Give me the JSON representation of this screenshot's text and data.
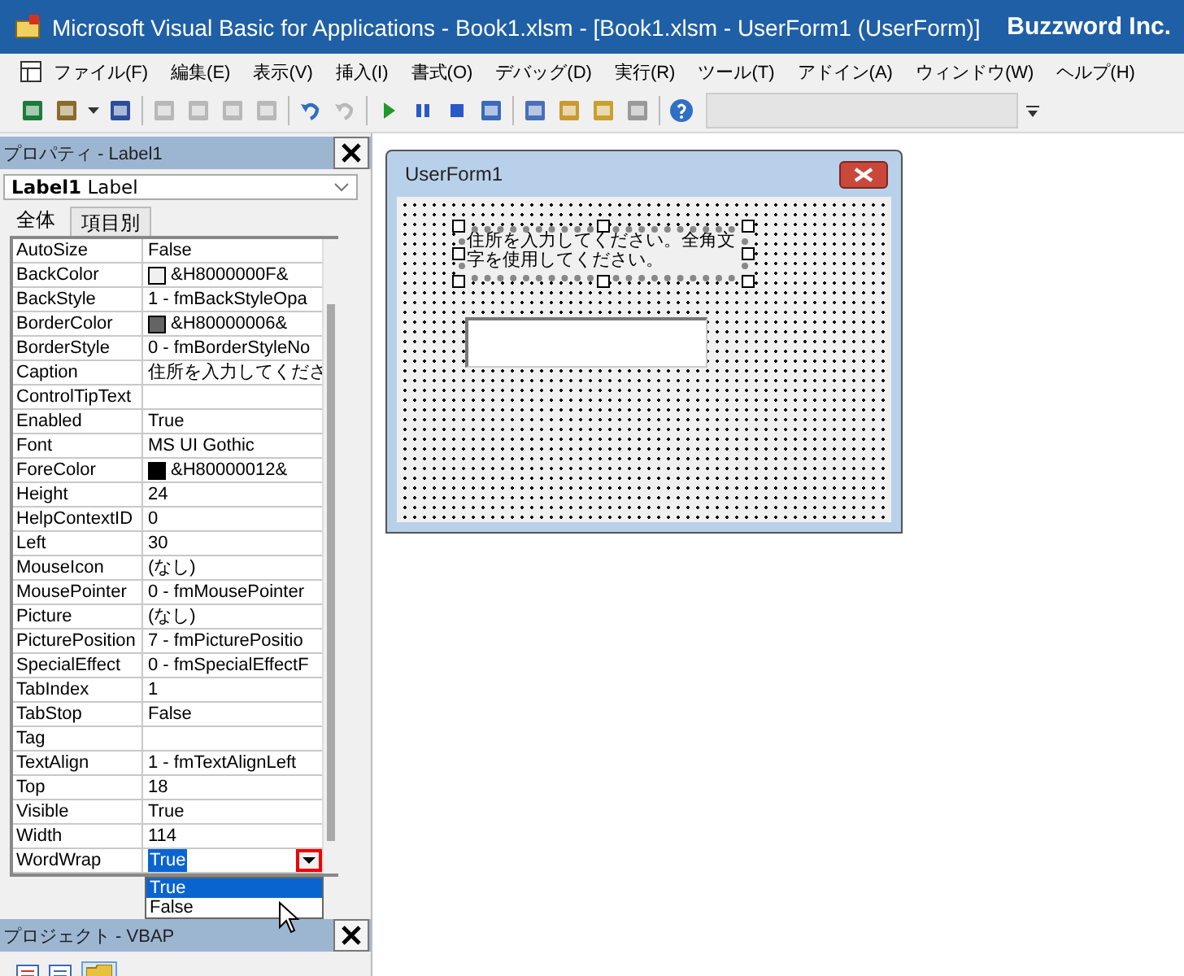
{
  "window": {
    "title": "Microsoft Visual Basic for Applications - Book1.xlsm - [Book1.xlsm - UserForm1 (UserForm)]",
    "brand": "Buzzword Inc."
  },
  "menu": [
    "ファイル(F)",
    "編集(E)",
    "表示(V)",
    "挿入(I)",
    "書式(O)",
    "デバッグ(D)",
    "実行(R)",
    "ツール(T)",
    "アドイン(A)",
    "ウィンドウ(W)",
    "ヘルプ(H)"
  ],
  "properties_panel": {
    "title": "プロパティ - Label1",
    "object_name": "Label1",
    "object_type": "Label",
    "tabs": [
      {
        "label": "全体",
        "selected": true
      },
      {
        "label": "項目別",
        "selected": false
      }
    ],
    "rows": [
      {
        "name": "AutoSize",
        "value": "False"
      },
      {
        "name": "BackColor",
        "value": "&H8000000F&",
        "color": "#f0f0f0"
      },
      {
        "name": "BackStyle",
        "value": "1 - fmBackStyleOpa"
      },
      {
        "name": "BorderColor",
        "value": "&H80000006&",
        "color": "#646464"
      },
      {
        "name": "BorderStyle",
        "value": "0 - fmBorderStyleNo"
      },
      {
        "name": "Caption",
        "value": "住所を入力してくださ"
      },
      {
        "name": "ControlTipText",
        "value": ""
      },
      {
        "name": "Enabled",
        "value": "True"
      },
      {
        "name": "Font",
        "value": "MS UI Gothic"
      },
      {
        "name": "ForeColor",
        "value": "&H80000012&",
        "color": "#000000"
      },
      {
        "name": "Height",
        "value": "24"
      },
      {
        "name": "HelpContextID",
        "value": "0"
      },
      {
        "name": "Left",
        "value": "30"
      },
      {
        "name": "MouseIcon",
        "value": "(なし)"
      },
      {
        "name": "MousePointer",
        "value": "0 - fmMousePointer"
      },
      {
        "name": "Picture",
        "value": "(なし)"
      },
      {
        "name": "PicturePosition",
        "value": "7 - fmPicturePositio"
      },
      {
        "name": "SpecialEffect",
        "value": "0 - fmSpecialEffectF"
      },
      {
        "name": "TabIndex",
        "value": "1"
      },
      {
        "name": "TabStop",
        "value": "False"
      },
      {
        "name": "Tag",
        "value": ""
      },
      {
        "name": "TextAlign",
        "value": "1 - fmTextAlignLeft"
      },
      {
        "name": "Top",
        "value": "18"
      },
      {
        "name": "Visible",
        "value": "True"
      },
      {
        "name": "Width",
        "value": "114"
      },
      {
        "name": "WordWrap",
        "value": "True",
        "editing": true
      }
    ],
    "dropdown": {
      "options": [
        {
          "label": "True",
          "selected": true
        },
        {
          "label": "False",
          "selected": false
        }
      ]
    }
  },
  "project_panel": {
    "title": "プロジェクト - VBAP"
  },
  "userform": {
    "title": "UserForm1",
    "label": {
      "text": "住所を入力してください。全角文字を使用してください。",
      "selected": true
    }
  }
}
